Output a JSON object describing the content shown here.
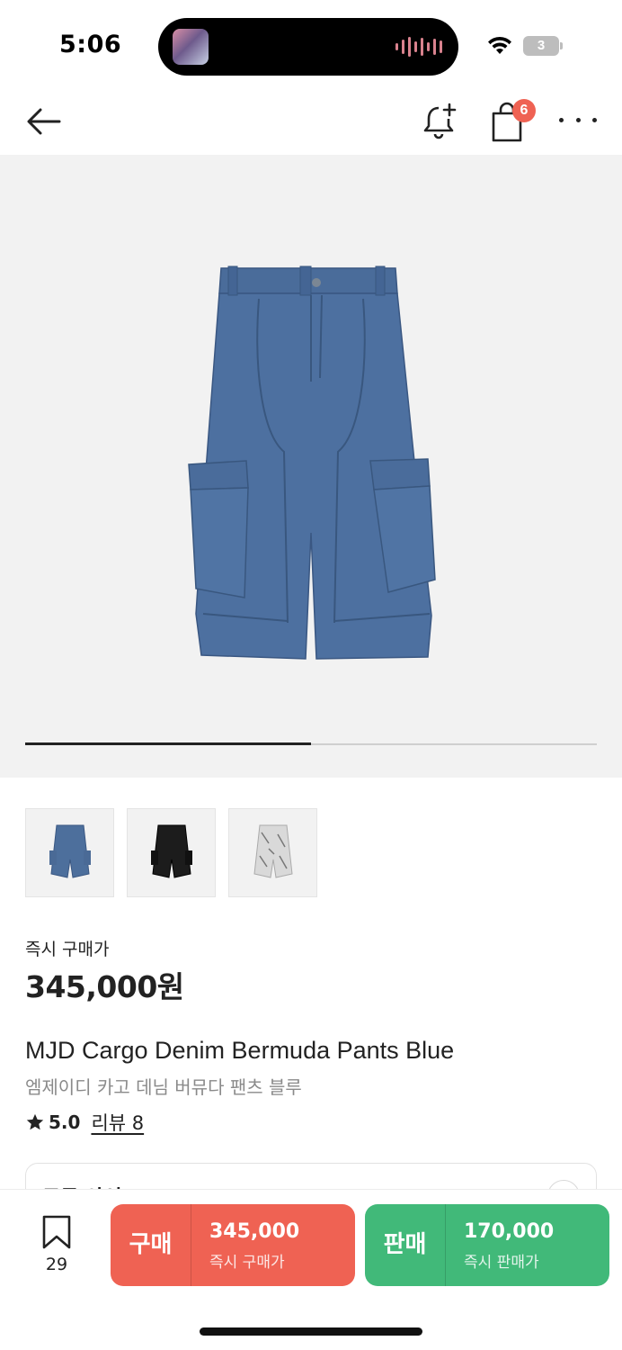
{
  "status_bar": {
    "time": "5:06",
    "battery_level": "3"
  },
  "nav": {
    "cart_count": "6",
    "icons": [
      "back-arrow-icon",
      "bell-plus-icon",
      "shopping-bag-icon",
      "more-icon"
    ]
  },
  "gallery": {
    "image_count": 3,
    "selected_index": 0,
    "progress": 0.5,
    "thumbnails": [
      {
        "name": "blue-denim",
        "color": "#4d6f9c"
      },
      {
        "name": "black-denim",
        "color": "#1c1c1c"
      },
      {
        "name": "white-pattern",
        "color": "#d7d7d7"
      }
    ]
  },
  "product": {
    "price_label": "즉시 구매가",
    "price": "345,000원",
    "name_en": "MJD Cargo Denim Bermuda Pants Blue",
    "name_ko": "엠제이디 카고 데님 버뮤다 팬츠 블루",
    "rating": "5.0",
    "review_label": "리뷰 8"
  },
  "size_selector": {
    "label": "모든 사이즈"
  },
  "bottom_bar": {
    "bookmark_count": "29",
    "buy": {
      "label": "구매",
      "price": "345,000",
      "sub": "즉시 구매가",
      "color": "#ef6253"
    },
    "sell": {
      "label": "판매",
      "price": "170,000",
      "sub": "즉시 판매가",
      "color": "#41b979"
    }
  }
}
